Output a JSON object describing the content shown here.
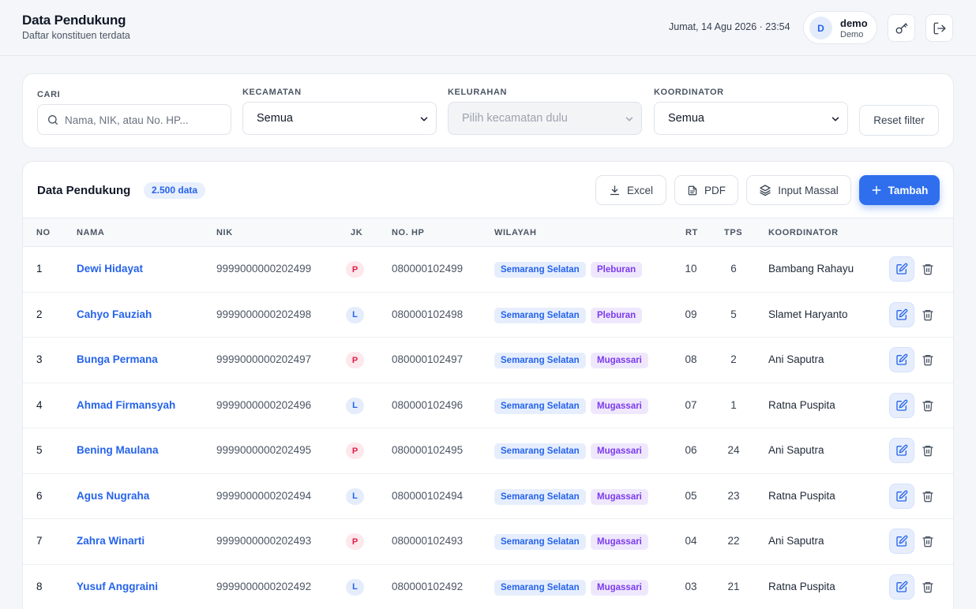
{
  "header": {
    "title": "Data Pendukung",
    "subtitle": "Daftar konstituen terdata",
    "datetime": "Jumat, 14 Agu 2026 · 23:54",
    "user": {
      "initial": "D",
      "name": "demo",
      "role": "Demo"
    },
    "icons": [
      "key-icon",
      "logout-icon"
    ]
  },
  "filters": {
    "search": {
      "label": "CARI",
      "placeholder": "Nama, NIK, atau No. HP..."
    },
    "kecamatan": {
      "label": "KECAMATAN",
      "value": "Semua"
    },
    "kelurahan": {
      "label": "KELURAHAN",
      "value": "Pilih kecamatan dulu"
    },
    "koordinator": {
      "label": "KOORDINATOR",
      "value": "Semua"
    },
    "reset_label": "Reset filter"
  },
  "table_card": {
    "title": "Data Pendukung",
    "count": "2.500 data",
    "actions": {
      "excel": "Excel",
      "pdf": "PDF",
      "bulk": "Input Massal",
      "add": "Tambah"
    },
    "columns": {
      "no": "NO",
      "nama": "NAMA",
      "nik": "NIK",
      "jk": "JK",
      "hp": "NO. HP",
      "wilayah": "WILAYAH",
      "rt": "RT",
      "tps": "TPS",
      "koordinator": "KOORDINATOR"
    },
    "rows": [
      {
        "no": "1",
        "nama": "Dewi Hidayat",
        "nik": "9999000000202499",
        "jk": "P",
        "hp": "080000102499",
        "kecamatan": "Semarang Selatan",
        "kelurahan": "Pleburan",
        "rt": "10",
        "tps": "6",
        "koordinator": "Bambang Rahayu"
      },
      {
        "no": "2",
        "nama": "Cahyo Fauziah",
        "nik": "9999000000202498",
        "jk": "L",
        "hp": "080000102498",
        "kecamatan": "Semarang Selatan",
        "kelurahan": "Pleburan",
        "rt": "09",
        "tps": "5",
        "koordinator": "Slamet Haryanto"
      },
      {
        "no": "3",
        "nama": "Bunga Permana",
        "nik": "9999000000202497",
        "jk": "P",
        "hp": "080000102497",
        "kecamatan": "Semarang Selatan",
        "kelurahan": "Mugassari",
        "rt": "08",
        "tps": "2",
        "koordinator": "Ani Saputra"
      },
      {
        "no": "4",
        "nama": "Ahmad Firmansyah",
        "nik": "9999000000202496",
        "jk": "L",
        "hp": "080000102496",
        "kecamatan": "Semarang Selatan",
        "kelurahan": "Mugassari",
        "rt": "07",
        "tps": "1",
        "koordinator": "Ratna Puspita"
      },
      {
        "no": "5",
        "nama": "Bening Maulana",
        "nik": "9999000000202495",
        "jk": "P",
        "hp": "080000102495",
        "kecamatan": "Semarang Selatan",
        "kelurahan": "Mugassari",
        "rt": "06",
        "tps": "24",
        "koordinator": "Ani Saputra"
      },
      {
        "no": "6",
        "nama": "Agus Nugraha",
        "nik": "9999000000202494",
        "jk": "L",
        "hp": "080000102494",
        "kecamatan": "Semarang Selatan",
        "kelurahan": "Mugassari",
        "rt": "05",
        "tps": "23",
        "koordinator": "Ratna Puspita"
      },
      {
        "no": "7",
        "nama": "Zahra Winarti",
        "nik": "9999000000202493",
        "jk": "P",
        "hp": "080000102493",
        "kecamatan": "Semarang Selatan",
        "kelurahan": "Mugassari",
        "rt": "04",
        "tps": "22",
        "koordinator": "Ani Saputra"
      },
      {
        "no": "8",
        "nama": "Yusuf Anggraini",
        "nik": "9999000000202492",
        "jk": "L",
        "hp": "080000102492",
        "kecamatan": "Semarang Selatan",
        "kelurahan": "Mugassari",
        "rt": "03",
        "tps": "21",
        "koordinator": "Ratna Puspita"
      }
    ]
  },
  "colors": {
    "accent": "#2f6fed",
    "link": "#2563eb",
    "female": "#e11d48",
    "kelurahan": "#7c3aed"
  }
}
